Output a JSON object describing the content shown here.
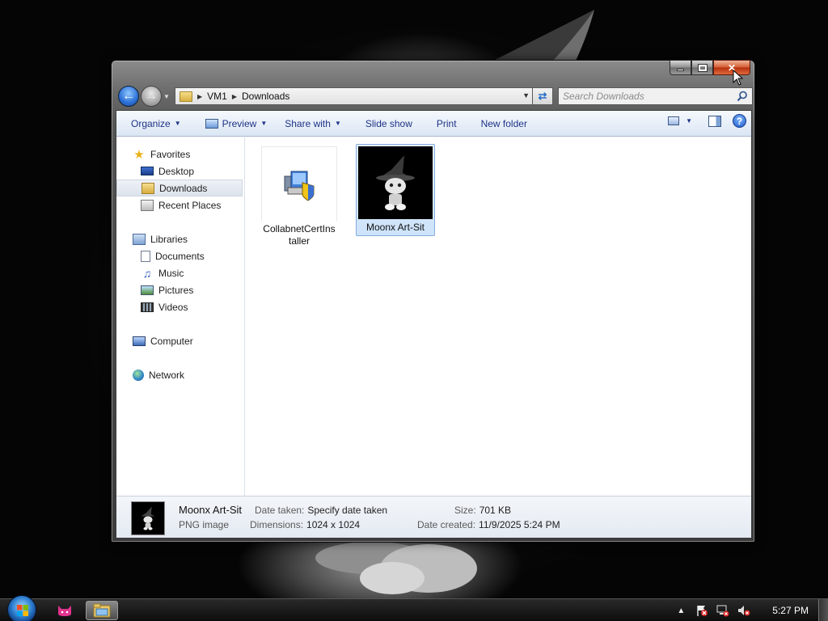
{
  "window": {
    "breadcrumb": [
      "VM1",
      "Downloads"
    ],
    "search_placeholder": "Search Downloads",
    "caption": {
      "close_glyph": "✕"
    }
  },
  "toolbar": {
    "organize": "Organize",
    "preview": "Preview",
    "share_with": "Share with",
    "slide_show": "Slide show",
    "print": "Print",
    "new_folder": "New folder",
    "help_glyph": "?"
  },
  "nav_pane": {
    "favorites": {
      "label": "Favorites",
      "items": [
        "Desktop",
        "Downloads",
        "Recent Places"
      ]
    },
    "libraries": {
      "label": "Libraries",
      "items": [
        "Documents",
        "Music",
        "Pictures",
        "Videos"
      ]
    },
    "computer": "Computer",
    "network": "Network",
    "selected": "Downloads"
  },
  "files": [
    {
      "name": "CollabnetCertInstaller",
      "icon": "installer-icon",
      "selected": false
    },
    {
      "name": "Moonx Art-Sit",
      "icon": "image-thumbnail",
      "selected": true
    }
  ],
  "details": {
    "name": "Moonx Art-Sit",
    "type": "PNG image",
    "date_taken_label": "Date taken:",
    "date_taken_value": "Specify date taken",
    "dimensions_label": "Dimensions:",
    "dimensions_value": "1024 x 1024",
    "size_label": "Size:",
    "size_value": "701 KB",
    "date_created_label": "Date created:",
    "date_created_value": "11/9/2025 5:24 PM"
  },
  "taskbar": {
    "clock": "5:27 PM"
  },
  "colors": {
    "toolbar_text": "#1e3287",
    "selection": "#cde3fa",
    "close_button": "#c83c14"
  }
}
